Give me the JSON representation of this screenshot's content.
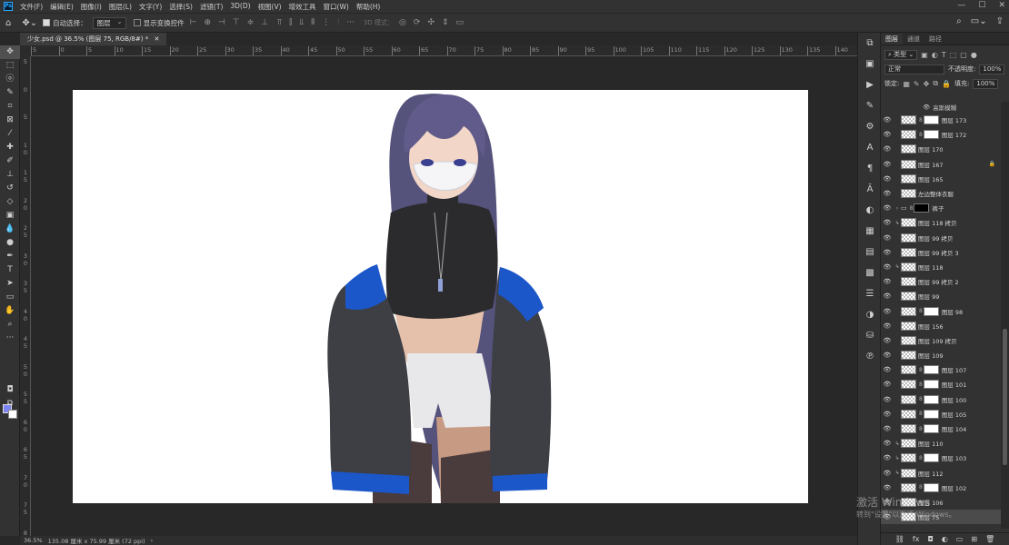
{
  "menubar": {
    "logo": "Ps",
    "items": [
      "文件(F)",
      "编辑(E)",
      "图像(I)",
      "图层(L)",
      "文字(Y)",
      "选择(S)",
      "滤镜(T)",
      "3D(D)",
      "视图(V)",
      "增效工具",
      "窗口(W)",
      "帮助(H)"
    ]
  },
  "options": {
    "auto_select_label": "自动选择：",
    "auto_select_value": "图层",
    "show_transform_label": "显示变换控件",
    "mode3d_label": "3D 模式："
  },
  "document": {
    "tab_title": "少女.psd @ 36.5% (图层 75, RGB/8#) *"
  },
  "ruler": {
    "h_labels": [
      "5",
      "0",
      "5",
      "10",
      "15",
      "20",
      "25",
      "30",
      "35",
      "40",
      "45",
      "50",
      "55",
      "60",
      "65",
      "70",
      "75",
      "80",
      "85",
      "90",
      "95",
      "100",
      "105",
      "110",
      "115",
      "120",
      "125",
      "130",
      "135",
      "140"
    ],
    "v_labels": [
      "5",
      "0",
      "5",
      "1 0",
      "1 5",
      "2 0",
      "2 5",
      "3 0",
      "3 5",
      "4 0",
      "4 5",
      "5 0",
      "5 5",
      "6 0",
      "6 5",
      "7 0",
      "7 5",
      "8 0"
    ]
  },
  "status": {
    "zoom": "36.5%",
    "doc_info": "135.08 厘米 x 75.99 厘米 (72 ppi)"
  },
  "layers_panel": {
    "tabs": [
      "图层",
      "通道",
      "路径"
    ],
    "filter_label": "类型",
    "blend_mode": "正常",
    "opacity_label": "不透明度:",
    "opacity_value": "100%",
    "lock_label": "锁定:",
    "fill_label": "填充:",
    "fill_value": "100%",
    "effects": [
      "高斯模糊"
    ],
    "layers": [
      {
        "name": "图层 173",
        "mask": "white",
        "clip": false
      },
      {
        "name": "图层 172",
        "mask": "white",
        "clip": false
      },
      {
        "name": "图层 170",
        "mask": "",
        "clip": false
      },
      {
        "name": "图层 167",
        "mask": "",
        "clip": false,
        "locked": true
      },
      {
        "name": "图层 165",
        "mask": "",
        "clip": false
      },
      {
        "name": "左边整体衣服",
        "mask": "",
        "clip": false
      },
      {
        "name": "裤子",
        "mask": "dark",
        "clip": false,
        "folder": true
      },
      {
        "name": "图层 118 拷贝",
        "mask": "",
        "clip": true
      },
      {
        "name": "图层 99 拷贝",
        "mask": "",
        "clip": false
      },
      {
        "name": "图层 99 拷贝 3",
        "mask": "",
        "clip": false
      },
      {
        "name": "图层 118",
        "mask": "",
        "clip": true
      },
      {
        "name": "图层 99 拷贝 2",
        "mask": "",
        "clip": false
      },
      {
        "name": "图层 99",
        "mask": "",
        "clip": false
      },
      {
        "name": "图层 98",
        "mask": "white",
        "clip": false
      },
      {
        "name": "图层 156",
        "mask": "",
        "clip": false
      },
      {
        "name": "图层 109 拷贝",
        "mask": "",
        "clip": false
      },
      {
        "name": "图层 109",
        "mask": "",
        "clip": false
      },
      {
        "name": "图层 107",
        "mask": "white",
        "clip": false
      },
      {
        "name": "图层 101",
        "mask": "white",
        "clip": false
      },
      {
        "name": "图层 100",
        "mask": "white",
        "clip": false
      },
      {
        "name": "图层 105",
        "mask": "white",
        "clip": false
      },
      {
        "name": "图层 104",
        "mask": "white",
        "clip": false
      },
      {
        "name": "图层 110",
        "mask": "",
        "clip": true
      },
      {
        "name": "图层 103",
        "mask": "white",
        "clip": true
      },
      {
        "name": "图层 112",
        "mask": "",
        "clip": true
      },
      {
        "name": "图层 102",
        "mask": "white",
        "clip": false
      },
      {
        "name": "图层 106",
        "mask": "",
        "clip": false
      },
      {
        "name": "图层 75",
        "mask": "",
        "clip": false,
        "selected": true
      }
    ]
  },
  "watermark": {
    "line1": "激活 Windows",
    "line2": "转到\"设置\"以激活 Windows。"
  },
  "colors": {
    "foreground": "#7d83f0",
    "background": "#ffffff"
  }
}
